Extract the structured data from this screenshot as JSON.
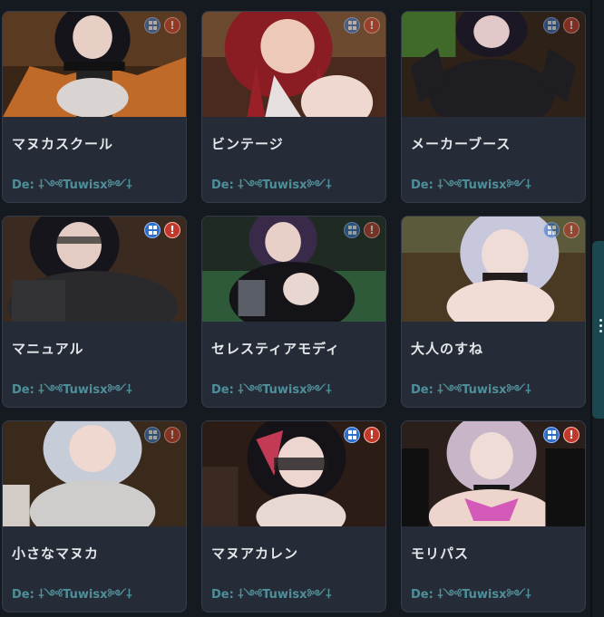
{
  "colors": {
    "background": "#151a21",
    "card": "#262c37",
    "title_text": "#e4e6ea",
    "author_text": "#4e8f9a",
    "platform_badge": "#2f6fc4",
    "warning_badge": "#c0392b",
    "scrollbar": "#1b4850"
  },
  "icons": {
    "platform": "windows-icon",
    "warning": "exclamation-icon"
  },
  "warning_symbol": "!",
  "avatars": [
    {
      "title": "マヌカスクール",
      "author": "De: ⸸༺Tuwisx༻⸸"
    },
    {
      "title": "ビンテージ",
      "author": "De: ⸸༺Tuwisx༻⸸"
    },
    {
      "title": "メーカーブース",
      "author": "De: ⸸༺Tuwisx༻⸸"
    },
    {
      "title": "マニュアル",
      "author": "De: ⸸༺Tuwisx༻⸸"
    },
    {
      "title": "セレスティアモディ",
      "author": "De: ⸸༺Tuwisx༻⸸"
    },
    {
      "title": "大人のすね",
      "author": "De: ⸸༺Tuwisx༻⸸"
    },
    {
      "title": "小さなマヌカ",
      "author": "De: ⸸༺Tuwisx༻⸸"
    },
    {
      "title": "マヌアカレン",
      "author": "De: ⸸༺Tuwisx༻⸸"
    },
    {
      "title": "モリパス",
      "author": "De: ⸸༺Tuwisx༻⸸"
    }
  ]
}
